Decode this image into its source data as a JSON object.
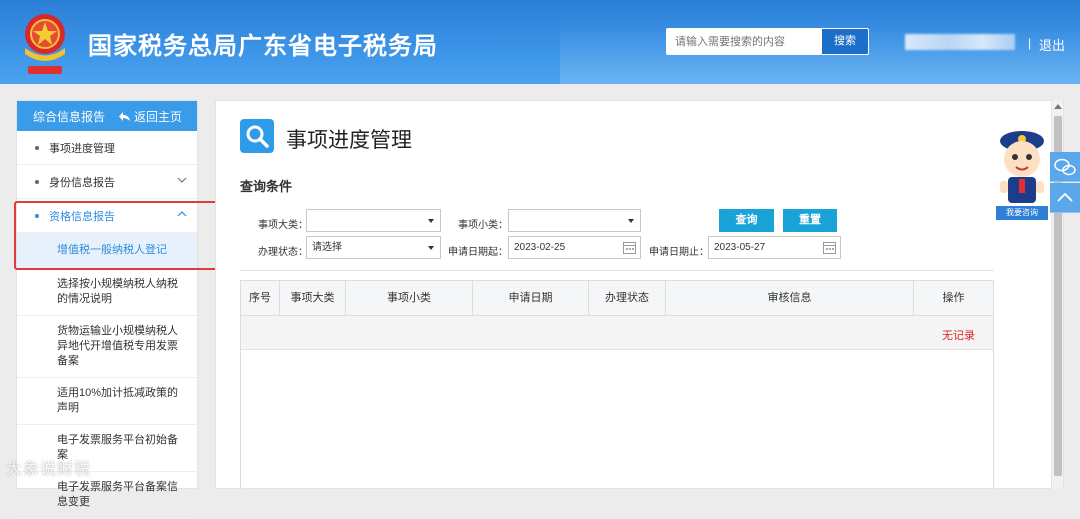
{
  "header": {
    "site_title": "国家税务总局广东省电子税务局",
    "search_placeholder": "请输入需要搜索的内容",
    "search_button": "搜索",
    "separator": "|",
    "logout": "退出"
  },
  "sidebar": {
    "title": "综合信息报告",
    "back_label": "返回主页",
    "items": [
      {
        "label": "事项进度管理"
      },
      {
        "label": "身份信息报告"
      },
      {
        "label": "资格信息报告"
      }
    ],
    "sub_items": [
      {
        "label": "增值税一般纳税人登记"
      },
      {
        "label": "选择按小规模纳税人纳税的情况说明"
      },
      {
        "label": "货物运输业小规模纳税人异地代开增值税专用发票备案"
      },
      {
        "label": "适用10%加计抵减政策的声明"
      },
      {
        "label": "电子发票服务平台初始备案"
      },
      {
        "label": "电子发票服务平台备案信息变更"
      }
    ]
  },
  "main": {
    "page_title": "事项进度管理",
    "section_title": "查询条件",
    "filters": {
      "category_label": "事项大类：",
      "category_value": "",
      "subcategory_label": "事项小类：",
      "subcategory_value": "",
      "status_label": "办理状态：",
      "status_value": "请选择",
      "date_from_label": "申请日期起：",
      "date_from_value": "2023-02-25",
      "date_to_label": "申请日期止：",
      "date_to_value": "2023-05-27"
    },
    "query_button": "查询",
    "reset_button": "重置",
    "table": {
      "headers": [
        "序号",
        "事项大类",
        "事项小类",
        "申请日期",
        "办理状态",
        "审核信息",
        "操作"
      ],
      "empty_text": "无记录"
    }
  },
  "assistant": {
    "label": "我要咨询"
  },
  "watermark": "大象说财税",
  "colors": {
    "header_blue": "#3a92e6",
    "accent_blue": "#3a9be9",
    "button_blue": "#1aa3d8",
    "highlight_red": "#e23b3b",
    "empty_red": "#e02020"
  }
}
